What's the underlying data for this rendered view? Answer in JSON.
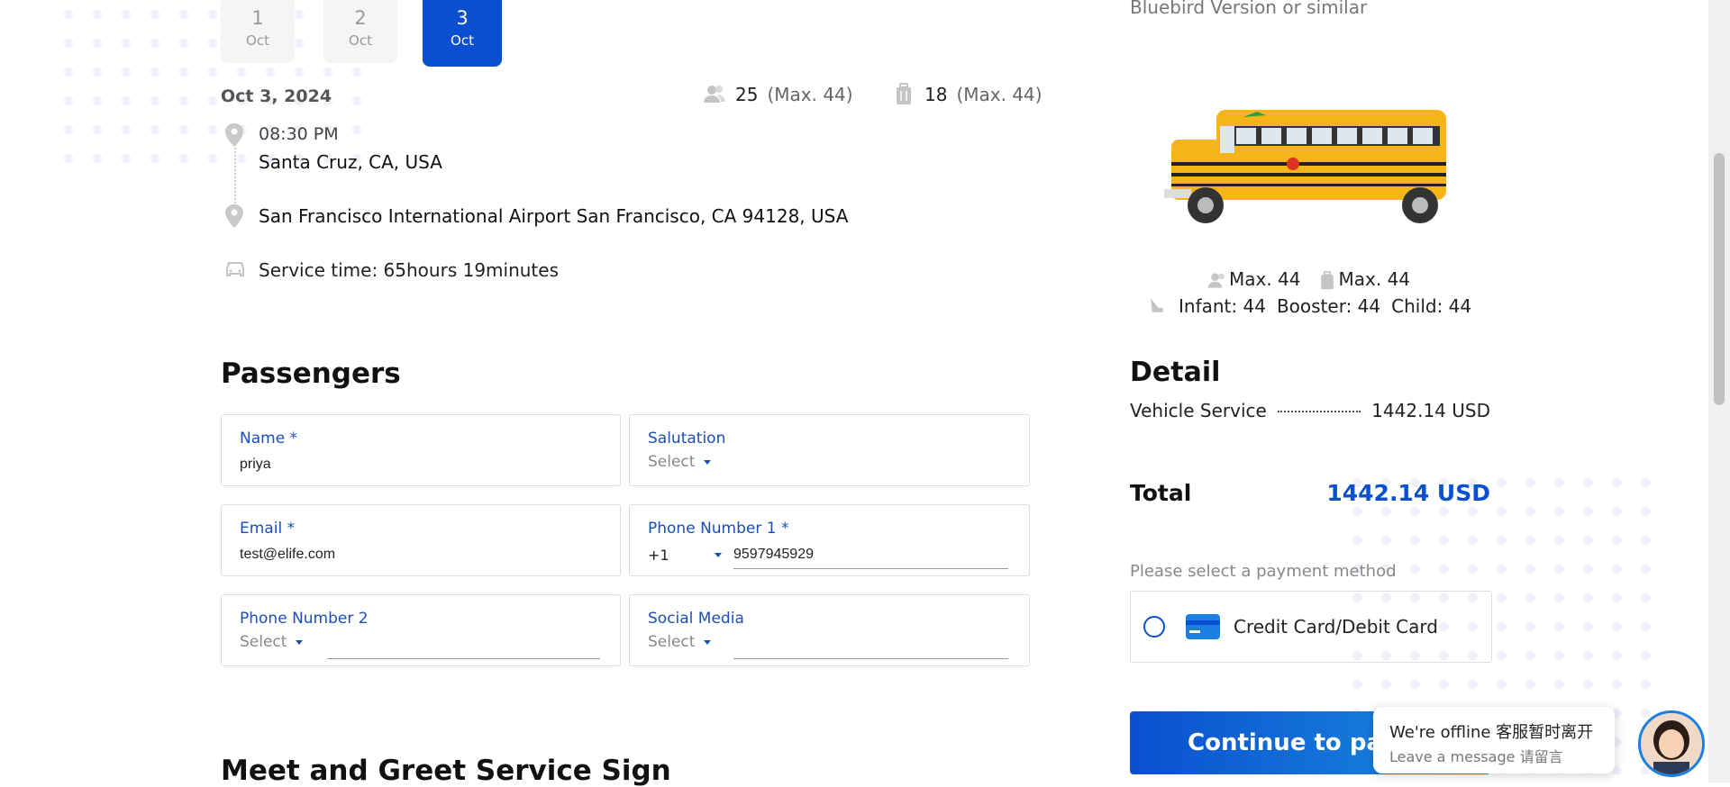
{
  "date_tabs": [
    {
      "day": "1",
      "month": "Oct",
      "active": false
    },
    {
      "day": "2",
      "month": "Oct",
      "active": false
    },
    {
      "day": "3",
      "month": "Oct",
      "active": true
    }
  ],
  "trip": {
    "date": "Oct 3, 2024",
    "passengers": "25",
    "passengers_max": "(Max. 44)",
    "luggage": "18",
    "luggage_max": "(Max. 44)",
    "time": "08:30 PM",
    "from": "Santa Cruz, CA, USA",
    "to": "San Francisco International Airport San Francisco, CA 94128, USA",
    "service_time": "Service time: 65hours 19minutes"
  },
  "passengers_section": {
    "title": "Passengers",
    "name": {
      "label": "Name *",
      "value": "priya"
    },
    "salutation": {
      "label": "Salutation",
      "value": "Select"
    },
    "email": {
      "label": "Email *",
      "value": "test@elife.com"
    },
    "phone1": {
      "label": "Phone Number 1 *",
      "code": "+1",
      "value": "9597945929"
    },
    "phone2": {
      "label": "Phone Number 2",
      "value": "Select"
    },
    "social": {
      "label": "Social Media",
      "value": "Select"
    }
  },
  "next_section_title": "Meet and Greet Service Sign",
  "vehicle": {
    "subtitle": "Bluebird Version or similar",
    "max_passengers": "Max. 44",
    "max_luggage": "Max. 44",
    "infant": "Infant: 44",
    "booster": "Booster: 44",
    "child": "Child: 44"
  },
  "detail": {
    "title": "Detail",
    "item_label": "Vehicle Service",
    "item_value": "1442.14 USD",
    "total_label": "Total",
    "total_value": "1442.14 USD"
  },
  "payment": {
    "hint": "Please select a payment method",
    "option": "Credit Card/Debit Card",
    "continue_label": "Continue to pay"
  },
  "chat": {
    "line1": "We're offline 客服暂时离开",
    "line2": "Leave a message 请留言"
  },
  "colors": {
    "accent": "#0a4fcf",
    "label_blue": "#1a4fb8"
  }
}
